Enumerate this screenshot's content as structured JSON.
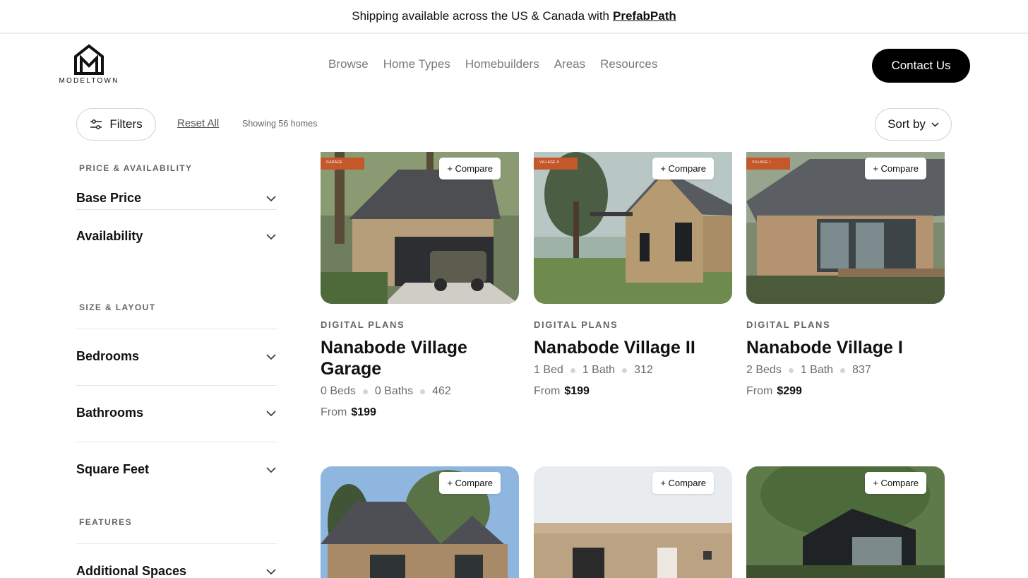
{
  "banner": {
    "text": "Shipping available across the US & Canada with",
    "link": "PrefabPath"
  },
  "logo": {
    "text": "MODELTOWN"
  },
  "nav": [
    "Browse",
    "Home Types",
    "Homebuilders",
    "Areas",
    "Resources"
  ],
  "contact_label": "Contact Us",
  "toolbar": {
    "filters": "Filters",
    "reset": "Reset All",
    "showing": "Showing 56 homes",
    "sort": "Sort by"
  },
  "sidebar": {
    "price_section": "PRICE & AVAILABILITY",
    "base_price": "Base Price",
    "availability": "Availability",
    "size_section": "SIZE & LAYOUT",
    "bedrooms": "Bedrooms",
    "bathrooms": "Bathrooms",
    "square_feet": "Square Feet",
    "features_section": "FEATURES",
    "additional_spaces": "Additional Spaces"
  },
  "compare_label": "+ Compare",
  "cards": [
    {
      "tag": "GARAGE",
      "type": "DIGITAL PLANS",
      "title": "Nanabode Village Garage",
      "beds": "0  Beds",
      "baths": "0 Baths",
      "sqft": "462",
      "from": "From",
      "price": "$199"
    },
    {
      "tag": "VILLAGE II",
      "type": "DIGITAL PLANS",
      "title": "Nanabode Village II",
      "beds": "1  Bed",
      "baths": "1 Bath",
      "sqft": "312",
      "from": "From",
      "price": "$199"
    },
    {
      "tag": "VILLAGE I",
      "type": "DIGITAL PLANS",
      "title": "Nanabode Village I",
      "beds": "2  Beds",
      "baths": "1 Bath",
      "sqft": "837",
      "from": "From",
      "price": "$299"
    }
  ],
  "colors": {
    "accent": "#000000",
    "tag": "#c4582a"
  }
}
